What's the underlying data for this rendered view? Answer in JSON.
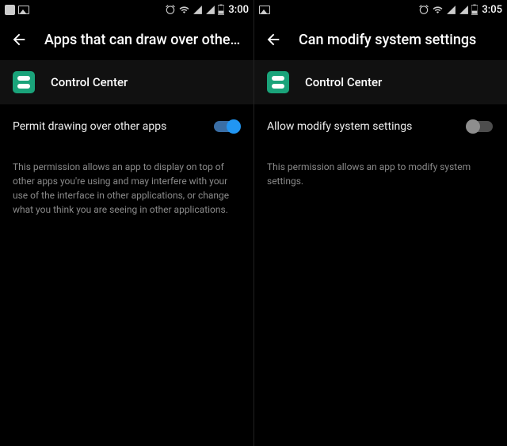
{
  "left": {
    "status": {
      "time": "3:00"
    },
    "title": "Apps that can draw over othe…",
    "app_name": "Control Center",
    "permission_label": "Permit drawing over other apps",
    "toggle_on": true,
    "description": "This permission allows an app to display on top of other apps you're using and may interfere with your use of the interface in other applications, or change what you think you are seeing in other applications."
  },
  "right": {
    "status": {
      "time": "3:05"
    },
    "title": "Can modify system settings",
    "app_name": "Control Center",
    "permission_label": "Allow modify system settings",
    "toggle_on": false,
    "description": "This permission allows an app to modify system settings."
  }
}
